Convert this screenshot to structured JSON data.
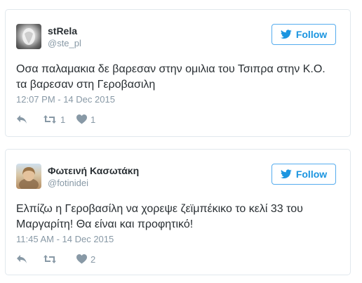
{
  "tweets": [
    {
      "author_name": "stRela",
      "handle": "@ste_pl",
      "follow_label": "Follow",
      "text_lines": [
        "Οσα παλαμακια δε βαρεσαν στην ομιλια του Τσιπρα στην Κ.Ο.",
        "τα βαρεσαν στη Γεροβασιλη"
      ],
      "timestamp": "12:07 PM - 14 Dec 2015",
      "retweet_count": "1",
      "like_count": "1"
    },
    {
      "author_name": "Φωτεινή Κασωτάκη",
      "handle": "@fotinidei",
      "follow_label": "Follow",
      "text_lines": [
        "Ελπίζω η Γεροβασίλη να χορεψε ζεϊμπέκικο το κελί 33 του",
        "Μαργαρίτη! Θα είναι και προφητικό!"
      ],
      "timestamp": "11:45 AM - 14 Dec 2015",
      "retweet_count": "",
      "like_count": "2"
    }
  ],
  "colors": {
    "twitter_blue": "#1b95e0",
    "border": "#e1e8ed",
    "text": "#292f33",
    "muted": "#8899a6"
  },
  "icons": {
    "follow": "twitter-bird-icon",
    "reply": "reply-icon",
    "retweet": "retweet-icon",
    "like": "heart-icon"
  }
}
